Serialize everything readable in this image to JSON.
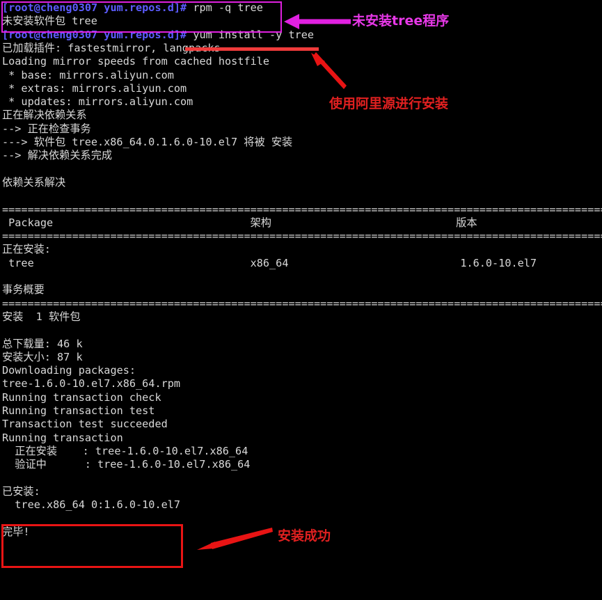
{
  "terminal": {
    "prompt": "[root@cheng0307 yum.repos.d]#",
    "lines": [
      {
        "type": "prompt",
        "prompt": "[root@cheng0307 yum.repos.d]#",
        "command": " rpm -q tree"
      },
      {
        "type": "text",
        "text": "未安装软件包 tree"
      },
      {
        "type": "prompt",
        "prompt": "[root@cheng0307 yum.repos.d]#",
        "command": " yum install -y tree"
      },
      {
        "type": "text",
        "text": "已加载插件: fastestmirror, langpacks"
      },
      {
        "type": "text",
        "text": "Loading mirror speeds from cached hostfile"
      },
      {
        "type": "text",
        "text": " * base: mirrors.aliyun.com"
      },
      {
        "type": "text",
        "text": " * extras: mirrors.aliyun.com"
      },
      {
        "type": "text",
        "text": " * updates: mirrors.aliyun.com"
      },
      {
        "type": "text",
        "text": "正在解决依赖关系"
      },
      {
        "type": "text",
        "text": "--> 正在检查事务"
      },
      {
        "type": "text",
        "text": "---> 软件包 tree.x86_64.0.1.6.0-10.el7 将被 安装"
      },
      {
        "type": "text",
        "text": "--> 解决依赖关系完成"
      },
      {
        "type": "text",
        "text": ""
      },
      {
        "type": "text",
        "text": "依赖关系解决"
      },
      {
        "type": "text",
        "text": ""
      },
      {
        "type": "sep",
        "text": "================================================================================================"
      },
      {
        "type": "text",
        "text": " Package                               架构                             版本"
      },
      {
        "type": "sep",
        "text": "================================================================================================"
      },
      {
        "type": "text",
        "text": "正在安装:"
      },
      {
        "type": "text",
        "text": " tree                                  x86_64                           1.6.0-10.el7"
      },
      {
        "type": "text",
        "text": ""
      },
      {
        "type": "text",
        "text": "事务概要"
      },
      {
        "type": "sep",
        "text": "================================================================================================"
      },
      {
        "type": "text",
        "text": "安装  1 软件包"
      },
      {
        "type": "text",
        "text": ""
      },
      {
        "type": "text",
        "text": "总下载量: 46 k"
      },
      {
        "type": "text",
        "text": "安装大小: 87 k"
      },
      {
        "type": "text",
        "text": "Downloading packages:"
      },
      {
        "type": "text",
        "text": "tree-1.6.0-10.el7.x86_64.rpm"
      },
      {
        "type": "text",
        "text": "Running transaction check"
      },
      {
        "type": "text",
        "text": "Running transaction test"
      },
      {
        "type": "text",
        "text": "Transaction test succeeded"
      },
      {
        "type": "text",
        "text": "Running transaction"
      },
      {
        "type": "text",
        "text": "  正在安装    : tree-1.6.0-10.el7.x86_64"
      },
      {
        "type": "text",
        "text": "  验证中      : tree-1.6.0-10.el7.x86_64"
      },
      {
        "type": "text",
        "text": ""
      },
      {
        "type": "text",
        "text": "已安装:"
      },
      {
        "type": "text",
        "text": "  tree.x86_64 0:1.6.0-10.el7"
      },
      {
        "type": "text",
        "text": ""
      },
      {
        "type": "text",
        "text": "完毕!"
      }
    ],
    "table": {
      "headers": [
        "Package",
        "架构",
        "版本"
      ],
      "rows": [
        {
          "section": "正在安装:",
          "package": "tree",
          "arch": "x86_64",
          "version": "1.6.0-10.el7"
        }
      ]
    },
    "summary": {
      "heading": "事务概要",
      "install_count_line": "安装  1 软件包",
      "download_size": "总下载量: 46 k",
      "installed_size": "安装大小: 87 k"
    },
    "installed": {
      "heading": "已安装:",
      "package_line": "tree.x86_64 0:1.6.0-10.el7",
      "complete": "完毕!"
    }
  },
  "annotations": [
    {
      "id": "not-installed",
      "label": "未安装tree程序",
      "color": "#e838e8"
    },
    {
      "id": "aliyun-mirror",
      "label": "使用阿里源进行安装",
      "color": "#e02020"
    },
    {
      "id": "install-success",
      "label": "安装成功",
      "color": "#e02020"
    }
  ],
  "colors": {
    "background": "#000000",
    "foreground": "#d8d8d8",
    "prompt_blue": "#5c5cff",
    "annotation_magenta": "#e838e8",
    "annotation_red": "#e02020",
    "box_magenta": "#e020e0",
    "box_red": "#e81414",
    "underline_red": "#ef3b3b"
  }
}
